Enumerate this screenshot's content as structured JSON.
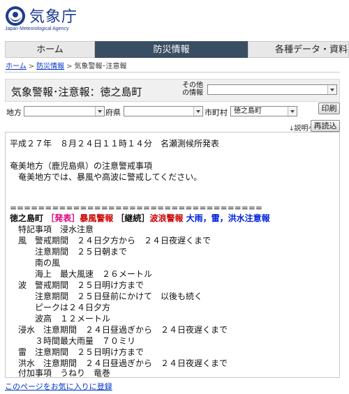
{
  "header": {
    "logo_jp": "気象庁",
    "logo_en": "Japan Meteorological Agency"
  },
  "gnav": {
    "tabs": [
      {
        "label": "ホーム"
      },
      {
        "label": "防災情報"
      },
      {
        "label": "各種データ・資料"
      }
    ]
  },
  "breadcrumb": {
    "items": [
      "ホーム",
      "防災情報",
      "気象警報･注意報"
    ],
    "sep": ">"
  },
  "titlebar": {
    "title": "気象警報･注意報：徳之島町",
    "other_label_line1": "その他",
    "other_label_line2": "の情報",
    "other_value": ""
  },
  "filters": {
    "region_label": "地方",
    "region_value": "",
    "pref_label": "府県",
    "pref_value": "",
    "city_label": "市町村",
    "city_value": "徳之島町",
    "print_label": "印刷",
    "explain_label": "説明へ",
    "reload_label": "再読込"
  },
  "content": {
    "issued": "平成２７年　８月２４日１１時１４分　名瀬測候所発表",
    "heading": "奄美地方（鹿児島県）の注意警戒事項",
    "summary": "　奄美地方では、暴風や高波に警戒してください。",
    "divider": "====================================",
    "town_line": {
      "town": "徳之島町",
      "tag1": "［発表］",
      "warn1": "暴風警報",
      "tag2": "［継続］",
      "warn2": "波浪警報",
      "adv": "大雨，雷，洪水注意報"
    },
    "lines": [
      "　特記事項　浸水注意",
      "　風　警戒期間　２４日夕方から　２４日夜遅くまで",
      "　　　注意期間　２５日朝まで",
      "　　　南の風",
      "　　　海上　最大風速　２６メートル",
      "　波　警戒期間　２５日明け方まで",
      "　　　注意期間　２５日昼前にかけて　以後も続く",
      "　　　ピークは２４日夕方",
      "　　　波高　１２メートル",
      "　浸水　注意期間　２４日昼過ぎから　２４日夜遅くまで",
      "　　　３時間最大雨量　７０ミリ",
      "　雷　注意期間　２５日明け方まで",
      "　洪水　注意期間　２４日昼過ぎから　２４日夜遅くまで",
      "　付加事項　うねり　竜巻"
    ]
  },
  "footer": {
    "bookmark_label": "このページをお気に入りに登録"
  },
  "colors": {
    "brand": "#1d3c8f",
    "nav_active": "#3a4e63",
    "warning_red": "#cc0000",
    "tag_magenta": "#e0007a",
    "advisory_blue": "#0020e0"
  }
}
